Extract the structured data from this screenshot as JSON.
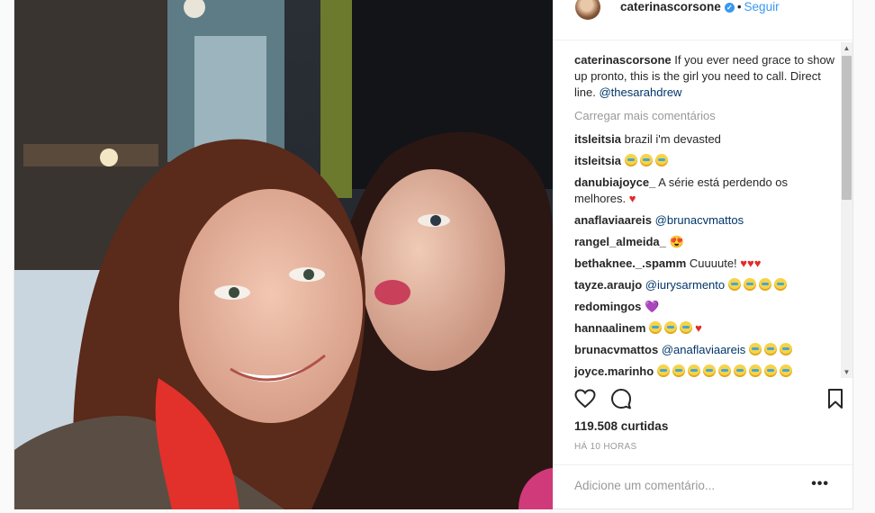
{
  "header": {
    "username": "caterinascorsone",
    "separator": "•",
    "follow_label": "Seguir"
  },
  "caption": {
    "username": "caterinascorsone",
    "text": "If you ever need grace to show up pronto, this is the girl you need to call. Direct line.",
    "mention": "@thesarahdrew"
  },
  "load_more": "Carregar mais comentários",
  "comments": [
    {
      "user": "itsleitsia",
      "text": "brazil i'm devasted",
      "emojis": 0,
      "hearts": 0
    },
    {
      "user": "itsleitsia",
      "text": "",
      "emojis": 3,
      "hearts": 0
    },
    {
      "user": "danubiajoyce_",
      "text": "A série está perdendo os melhores.",
      "emojis": 0,
      "hearts": 1
    },
    {
      "user": "anaflaviaareis",
      "text": "@brunacvmattos",
      "emojis": 0,
      "hearts": 0
    },
    {
      "user": "rangel_almeida_",
      "text": "😍",
      "emojis": 0,
      "hearts": 0
    },
    {
      "user": "bethaknee._.spamm",
      "text": "Cuuuute!",
      "emojis": 0,
      "hearts": 3
    },
    {
      "user": "tayze.araujo",
      "text": "@iurysarmento",
      "emojis": 4,
      "hearts": 0
    },
    {
      "user": "redomingos",
      "text": "💜",
      "emojis": 0,
      "hearts": 0
    },
    {
      "user": "hannaalinem",
      "text": "",
      "emojis": 3,
      "hearts": 1
    },
    {
      "user": "brunacvmattos",
      "text": "@anaflaviaareis",
      "emojis": 3,
      "hearts": 0
    },
    {
      "user": "joyce.marinho",
      "text": "",
      "emojis": 9,
      "hearts": 0
    }
  ],
  "likes": "119.508 curtidas",
  "time": "HÁ 10 HORAS",
  "add_comment_placeholder": "Adicione um comentário...",
  "options_label": "•••",
  "colors": {
    "accent": "#3897f0",
    "heart": "#e32a2a"
  }
}
